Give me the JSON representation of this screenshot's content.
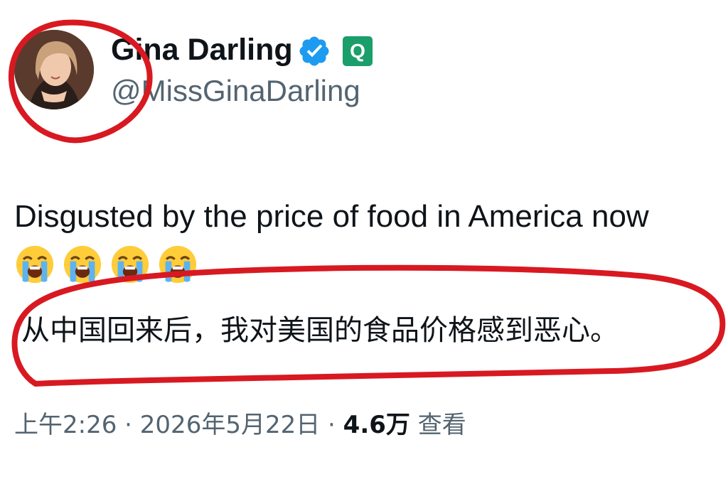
{
  "author": {
    "display_name": "Gina Darling",
    "handle": "@MissGinaDarling",
    "verified_icon": "verified-checkmark-icon",
    "affiliation_badge_letter": "Q",
    "affiliation_badge_color": "#1a9e6a"
  },
  "tweet": {
    "text_en": "Disgusted by the price of food in America now",
    "emoji": [
      "😭",
      "😭",
      "😭",
      "😭"
    ],
    "text_zh": "从中国回来后，我对美国的食品价格感到恶心。"
  },
  "meta": {
    "time": "上午2:26",
    "separator": "·",
    "date": "2026年5月22日",
    "views_count": "4.6万",
    "views_label": "查看"
  },
  "colors": {
    "annotation_red": "#d81921",
    "verified_blue": "#1d9bf0",
    "secondary_text": "#536471"
  }
}
